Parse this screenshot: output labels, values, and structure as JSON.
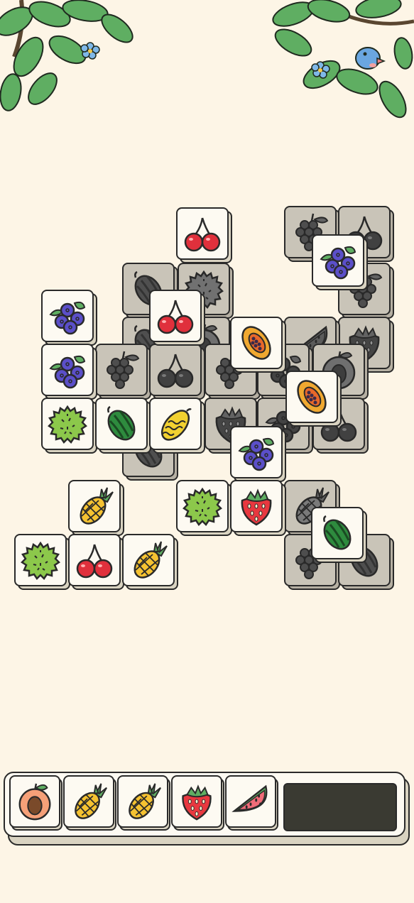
{
  "game": {
    "tray_capacity": 7,
    "tray_filled": 5,
    "tray": [
      "peach",
      "pineapple",
      "pineapple",
      "strawberry",
      "watermelon-slice"
    ]
  },
  "tiles": [
    {
      "fruit": "grapes",
      "state": "blocked"
    },
    {
      "fruit": "cherry",
      "state": "blocked"
    },
    {
      "fruit": "watermelon",
      "state": "blocked"
    },
    {
      "fruit": "durian",
      "state": "blocked"
    },
    {
      "fruit": "grapes",
      "state": "blocked"
    },
    {
      "fruit": "watermelon",
      "state": "blocked"
    },
    {
      "fruit": "peach",
      "state": "blocked"
    },
    {
      "fruit": "strawberry",
      "state": "blocked"
    },
    {
      "fruit": "watermelon-slice",
      "state": "blocked"
    },
    {
      "fruit": "grapes",
      "state": "blocked"
    },
    {
      "fruit": "cherry",
      "state": "blocked"
    },
    {
      "fruit": "grapes",
      "state": "blocked"
    },
    {
      "fruit": "blueberry",
      "state": "blocked"
    },
    {
      "fruit": "peach",
      "state": "blocked"
    },
    {
      "fruit": "strawberry",
      "state": "blocked"
    },
    {
      "fruit": "blueberry",
      "state": "blocked"
    },
    {
      "fruit": "cherry",
      "state": "blocked"
    },
    {
      "fruit": "watermelon",
      "state": "blocked"
    },
    {
      "fruit": "pineapple",
      "state": "blocked"
    },
    {
      "fruit": "grapes",
      "state": "blocked"
    },
    {
      "fruit": "watermelon",
      "state": "blocked"
    },
    {
      "fruit": "cherry",
      "state": "free"
    },
    {
      "fruit": "blueberry",
      "state": "free"
    },
    {
      "fruit": "cherry",
      "state": "free"
    },
    {
      "fruit": "blueberry",
      "state": "free"
    },
    {
      "fruit": "blueberry",
      "state": "free"
    },
    {
      "fruit": "papaya",
      "state": "free"
    },
    {
      "fruit": "durian",
      "state": "free"
    },
    {
      "fruit": "watermelon",
      "state": "free"
    },
    {
      "fruit": "melon",
      "state": "free"
    },
    {
      "fruit": "papaya",
      "state": "free"
    },
    {
      "fruit": "blueberry",
      "state": "free"
    },
    {
      "fruit": "pineapple",
      "state": "free"
    },
    {
      "fruit": "durian",
      "state": "free"
    },
    {
      "fruit": "strawberry",
      "state": "free"
    },
    {
      "fruit": "watermelon",
      "state": "free"
    },
    {
      "fruit": "durian",
      "state": "free"
    },
    {
      "fruit": "cherry",
      "state": "free"
    },
    {
      "fruit": "pineapple",
      "state": "free"
    }
  ]
}
